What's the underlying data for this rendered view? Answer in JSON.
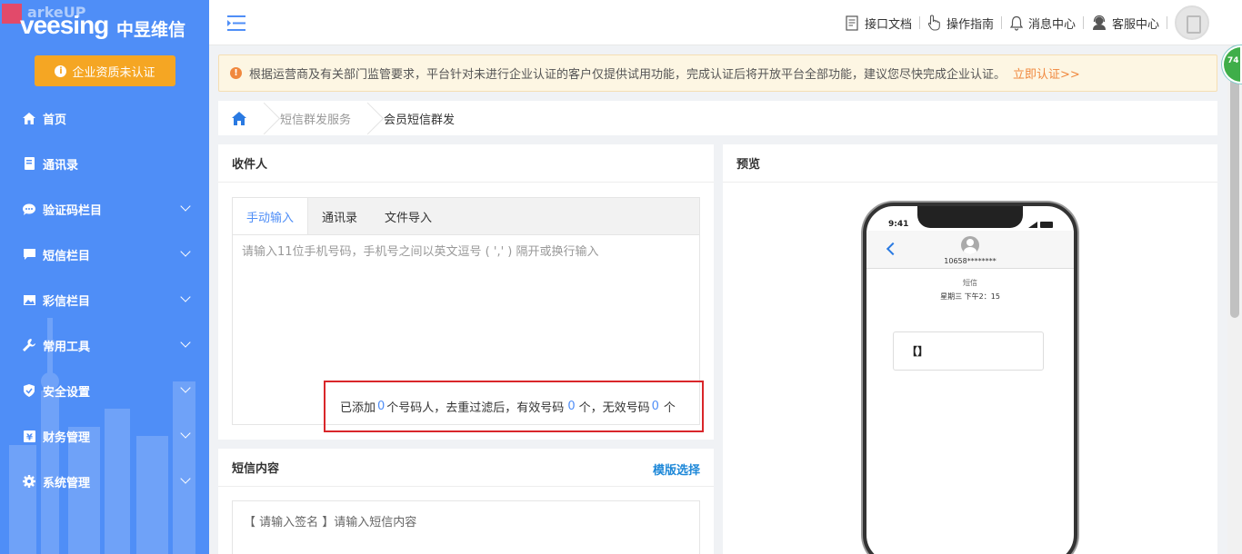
{
  "brand": {
    "watermark": "arkeUP",
    "logo_text": "veesing",
    "logo_cn": "中昱维信"
  },
  "sidebar": {
    "cert_button": "企业资质未认证",
    "items": [
      {
        "label": "首页",
        "icon": "home-icon",
        "expandable": false
      },
      {
        "label": "通讯录",
        "icon": "address-book-icon",
        "expandable": false
      },
      {
        "label": "验证码栏目",
        "icon": "chat-bubble-icon",
        "expandable": true
      },
      {
        "label": "短信栏目",
        "icon": "message-icon",
        "expandable": true
      },
      {
        "label": "彩信栏目",
        "icon": "image-icon",
        "expandable": true
      },
      {
        "label": "常用工具",
        "icon": "wrench-icon",
        "expandable": true
      },
      {
        "label": "安全设置",
        "icon": "shield-icon",
        "expandable": true
      },
      {
        "label": "财务管理",
        "icon": "yen-icon",
        "expandable": true
      },
      {
        "label": "系统管理",
        "icon": "gear-icon",
        "expandable": true
      }
    ]
  },
  "header": {
    "links": [
      {
        "label": "接口文档",
        "icon": "document-icon"
      },
      {
        "label": "操作指南",
        "icon": "hand-pointer-icon"
      },
      {
        "label": "消息中心",
        "icon": "bell-icon"
      },
      {
        "label": "客服中心",
        "icon": "support-agent-icon"
      }
    ]
  },
  "notice": {
    "text": "根据运营商及有关部门监管要求，平台针对未进行企业认证的客户仅提供试用功能，完成认证后将开放平台全部功能，建议您尽快完成企业认证。",
    "link": "立即认证>>"
  },
  "breadcrumb": {
    "items": [
      "短信群发服务",
      "会员短信群发"
    ]
  },
  "recipients": {
    "title": "收件人",
    "tabs": [
      "手动输入",
      "通讯录",
      "文件导入"
    ],
    "active_tab": 0,
    "placeholder": "请输入11位手机号码，手机号之间以英文逗号 ( ',' ) 隔开或换行输入",
    "summary": {
      "part1": "已添加",
      "added": "0",
      "part2": "个号码人，去重过滤后，有效号码",
      "valid": "0",
      "part3": "个，无效号码",
      "invalid": "0",
      "part4": "个"
    }
  },
  "sms": {
    "title": "短信内容",
    "template_link": "模版选择",
    "placeholder": "【 请输入签名 】请输入短信内容"
  },
  "preview": {
    "title": "预览",
    "phone": {
      "time": "9:41",
      "contact": "10658********",
      "label": "短信",
      "timestamp": "星期三 下午2：15",
      "bubble": "【】"
    }
  },
  "badge": "74",
  "colors": {
    "sidebar": "#4f8ef7",
    "accent": "#4f8ef7",
    "warning": "#f5a623",
    "highlight_border": "#d9262a"
  }
}
